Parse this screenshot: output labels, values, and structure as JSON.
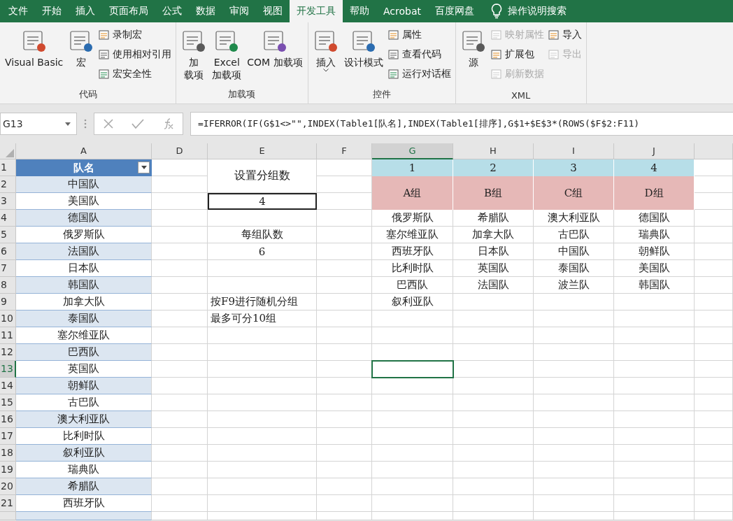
{
  "tabs": [
    {
      "label": "文件",
      "selected": false
    },
    {
      "label": "开始",
      "selected": false
    },
    {
      "label": "插入",
      "selected": false
    },
    {
      "label": "页面布局",
      "selected": false
    },
    {
      "label": "公式",
      "selected": false
    },
    {
      "label": "数据",
      "selected": false
    },
    {
      "label": "审阅",
      "selected": false
    },
    {
      "label": "视图",
      "selected": false
    },
    {
      "label": "开发工具",
      "selected": true
    },
    {
      "label": "帮助",
      "selected": false
    },
    {
      "label": "Acrobat",
      "selected": false
    },
    {
      "label": "百度网盘",
      "selected": false
    }
  ],
  "search": {
    "label": "操作说明搜索"
  },
  "ribbon_groups": [
    {
      "label": "代码",
      "controls": [
        {
          "kind": "large",
          "lines": [
            "Visual Basic"
          ]
        },
        {
          "kind": "large",
          "lines": [
            "宏"
          ]
        },
        {
          "kind": "stack",
          "items": [
            {
              "label": "录制宏",
              "disabled": false
            },
            {
              "label": "使用相对引用",
              "disabled": false
            },
            {
              "label": "宏安全性",
              "disabled": false
            }
          ]
        }
      ]
    },
    {
      "label": "加载项",
      "controls": [
        {
          "kind": "large",
          "lines": [
            "加",
            "载项"
          ]
        },
        {
          "kind": "large",
          "lines": [
            "Excel",
            "加载项"
          ]
        },
        {
          "kind": "large",
          "lines": [
            "COM 加载项"
          ]
        }
      ]
    },
    {
      "label": "控件",
      "controls": [
        {
          "kind": "menu",
          "lines": [
            "插入"
          ]
        },
        {
          "kind": "large",
          "lines": [
            "设计模式"
          ]
        },
        {
          "kind": "stack",
          "items": [
            {
              "label": "属性",
              "disabled": false
            },
            {
              "label": "查看代码",
              "disabled": false
            },
            {
              "label": "运行对话框",
              "disabled": false
            }
          ]
        }
      ]
    },
    {
      "label": "XML",
      "controls": [
        {
          "kind": "large",
          "lines": [
            "源"
          ]
        },
        {
          "kind": "stack",
          "items": [
            {
              "label": "映射属性",
              "disabled": true
            },
            {
              "label": "扩展包",
              "disabled": false
            },
            {
              "label": "刷新数据",
              "disabled": true
            }
          ]
        },
        {
          "kind": "stack",
          "items": [
            {
              "label": "导入",
              "disabled": false
            },
            {
              "label": "导出",
              "disabled": true
            }
          ]
        }
      ]
    }
  ],
  "name_box": "G13",
  "formula": "=IFERROR(IF(G$1<>\"\",INDEX(Table1[队名],INDEX(Table1[排序],G$1+$E$3*(ROWS($F$2:F11)",
  "columns": [
    {
      "label": "A",
      "selected": false
    },
    {
      "label": "D",
      "selected": false
    },
    {
      "label": "E",
      "selected": false
    },
    {
      "label": "F",
      "selected": false
    },
    {
      "label": "G",
      "selected": true
    },
    {
      "label": "H",
      "selected": false
    },
    {
      "label": "I",
      "selected": false
    },
    {
      "label": "J",
      "selected": false
    }
  ],
  "rows": [
    {
      "label": "1",
      "selected": false
    },
    {
      "label": "2",
      "selected": false
    },
    {
      "label": "3",
      "selected": false
    },
    {
      "label": "4",
      "selected": false
    },
    {
      "label": "5",
      "selected": false
    },
    {
      "label": "6",
      "selected": false
    },
    {
      "label": "7",
      "selected": false
    },
    {
      "label": "8",
      "selected": false
    },
    {
      "label": "9",
      "selected": false
    },
    {
      "label": "10",
      "selected": false
    },
    {
      "label": "11",
      "selected": false
    },
    {
      "label": "12",
      "selected": false
    },
    {
      "label": "13",
      "selected": true
    },
    {
      "label": "14",
      "selected": false
    },
    {
      "label": "15",
      "selected": false
    },
    {
      "label": "16",
      "selected": false
    },
    {
      "label": "17",
      "selected": false
    },
    {
      "label": "18",
      "selected": false
    },
    {
      "label": "19",
      "selected": false
    },
    {
      "label": "20",
      "selected": false
    },
    {
      "label": "21",
      "selected": false
    }
  ],
  "team_list": {
    "header": "队名",
    "teams": [
      "中国队",
      "美国队",
      "德国队",
      "俄罗斯队",
      "法国队",
      "日本队",
      "韩国队",
      "加拿大队",
      "泰国队",
      "塞尔维亚队",
      "巴西队",
      "英国队",
      "朝鲜队",
      "古巴队",
      "澳大利亚队",
      "比利时队",
      "叙利亚队",
      "瑞典队",
      "希腊队",
      "西班牙队"
    ]
  },
  "settings": {
    "group_count_label": "设置分组数",
    "group_count": "4",
    "per_group_label": "每组队数",
    "per_group": "6",
    "notes": [
      "按F9进行随机分组",
      "最多可分10组"
    ]
  },
  "groups": [
    {
      "number": "1",
      "name": "A组",
      "members": [
        "俄罗斯队",
        "塞尔维亚队",
        "西班牙队",
        "比利时队",
        "巴西队",
        "叙利亚队"
      ]
    },
    {
      "number": "2",
      "name": "B组",
      "members": [
        "希腊队",
        "加拿大队",
        "日本队",
        "英国队",
        "法国队"
      ]
    },
    {
      "number": "3",
      "name": "C组",
      "members": [
        "澳大利亚队",
        "古巴队",
        "中国队",
        "泰国队",
        "波兰队"
      ]
    },
    {
      "number": "4",
      "name": "D组",
      "members": [
        "德国队",
        "瑞典队",
        "朝鲜队",
        "美国队",
        "韩国队"
      ]
    }
  ]
}
